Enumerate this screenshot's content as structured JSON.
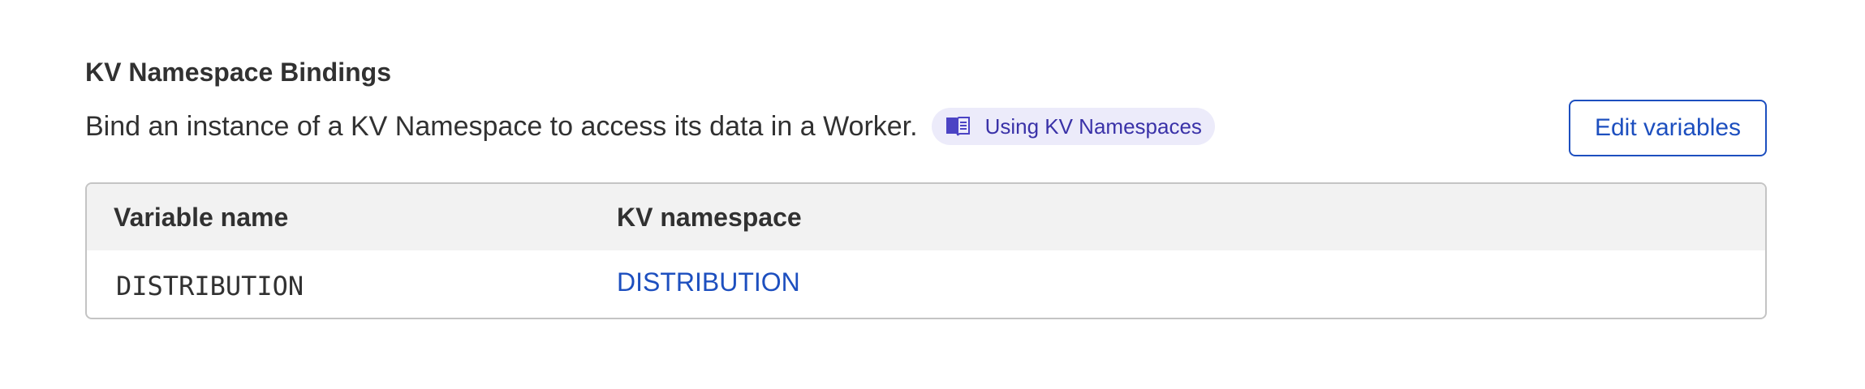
{
  "section": {
    "title": "KV Namespace Bindings",
    "description": "Bind an instance of a KV Namespace to access its data in a Worker.",
    "doc_link": {
      "label": "Using KV Namespaces",
      "icon": "book-icon"
    },
    "edit_button_label": "Edit variables"
  },
  "table": {
    "columns": [
      "Variable name",
      "KV namespace"
    ],
    "rows": [
      {
        "variable_name": "DISTRIBUTION",
        "kv_namespace": "DISTRIBUTION"
      }
    ]
  },
  "colors": {
    "accent": "#1d4fbf",
    "pill_background": "#ecebfa",
    "pill_text": "#3a32a8",
    "header_background": "#f2f2f2",
    "border": "#c4c4c4"
  }
}
